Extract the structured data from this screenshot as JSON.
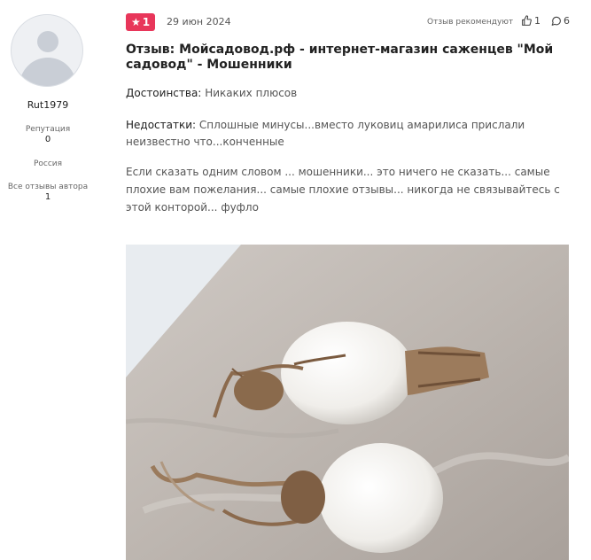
{
  "author": {
    "name": "Rut1979",
    "reputation_label": "Репутация",
    "reputation_value": "0",
    "country": "Россия",
    "all_reviews_label": "Все отзывы автора",
    "all_reviews_count": "1"
  },
  "review": {
    "rating": "1",
    "date": "29 июн 2024",
    "recommends_label": "Отзыв рекомендуют",
    "likes": "1",
    "comments": "6",
    "title": "Отзыв: Мойсадовод.рф - интернет-магазин саженцев \"Мой садовод\" - Мошенники",
    "pros_label": "Достоинства:",
    "pros_text": "Никаких плюсов",
    "cons_label": "Недостатки:",
    "cons_text": "Сплошные минусы...вместо луковиц амарилиса прислали неизвестно что...конченные",
    "body": "Если сказать одним словом ... мошенники... это ничего не сказать... самые плохие вам пожелания... самые плохие отзывы... никогда не связывайтесь с этой конторой... фуфло"
  },
  "colors": {
    "badge": "#e8365a",
    "text": "#222222",
    "muted": "#555555"
  }
}
